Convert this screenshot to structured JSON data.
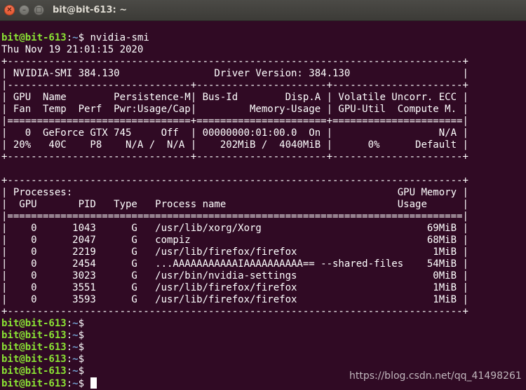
{
  "window": {
    "title": "bit@bit-613: ~",
    "close_glyph": "✕",
    "min_glyph": "–",
    "max_glyph": "□"
  },
  "prompt": {
    "user_host": "bit@bit-613",
    "separator": ":",
    "path": "~",
    "symbol": "$"
  },
  "command_text": " nvidia-smi",
  "timestamp": "Thu Nov 19 21:01:15 2020",
  "table_lines": [
    "+-----------------------------------------------------------------------------+",
    "| NVIDIA-SMI 384.130                Driver Version: 384.130                   |",
    "|-------------------------------+----------------------+----------------------+",
    "| GPU  Name        Persistence-M| Bus-Id        Disp.A | Volatile Uncorr. ECC |",
    "| Fan  Temp  Perf  Pwr:Usage/Cap|         Memory-Usage | GPU-Util  Compute M. |",
    "|===============================+======================+======================|",
    "|   0  GeForce GTX 745     Off  | 00000000:01:00.0  On |                  N/A |",
    "| 20%   40C    P8    N/A /  N/A |    202MiB /  4040MiB |      0%      Default |",
    "+-------------------------------+----------------------+----------------------+",
    "",
    "+-----------------------------------------------------------------------------+",
    "| Processes:                                                       GPU Memory |",
    "|  GPU       PID   Type   Process name                             Usage      |",
    "|=============================================================================|",
    "|    0      1043      G   /usr/lib/xorg/Xorg                            69MiB |",
    "|    0      2047      G   compiz                                        68MiB |",
    "|    0      2219      G   /usr/lib/firefox/firefox                       1MiB |",
    "|    0      2454      G   ...AAAAAAAAAAAIAAAAAAAAAA== --shared-files    54MiB |",
    "|    0      3023      G   /usr/bin/nvidia-settings                       0MiB |",
    "|    0      3551      G   /usr/lib/firefox/firefox                       1MiB |",
    "|    0      3593      G   /usr/lib/firefox/firefox                       1MiB |",
    "+-----------------------------------------------------------------------------+"
  ],
  "watermark": "https://blog.csdn.net/qq_41498261"
}
